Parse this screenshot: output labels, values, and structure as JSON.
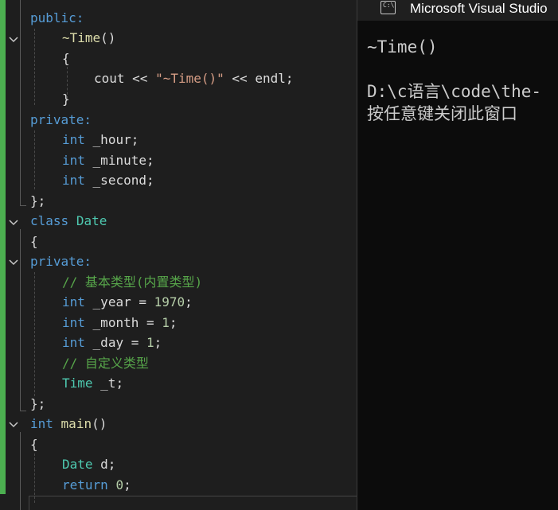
{
  "editor": {
    "line_public": "public:",
    "dtor_name": "~Time",
    "parens": "()",
    "brace_open": "{",
    "brace_close": "}",
    "cout": "cout",
    "stream_op": "<<",
    "string_literal": "\"~Time()\"",
    "endl": "endl;",
    "private_label": "private:",
    "kw_int": "int",
    "var_hour": "_hour;",
    "var_minute": "_minute;",
    "var_second": "_second;",
    "class_end": "};",
    "kw_class": "class",
    "class_name": "Date",
    "comment_builtin": "// 基本类型(内置类型)",
    "var_year": "_year",
    "var_month": "_month",
    "var_day": "_day",
    "eq": "=",
    "num_1970": "1970",
    "num_1": "1",
    "semicolon": ";",
    "comment_custom": "// 自定义类型",
    "type_time": "Time",
    "var_t": "_t;",
    "fn_main": "main",
    "type_date": "Date",
    "var_d": "d;",
    "kw_return": "return",
    "num_0": "0"
  },
  "console": {
    "window_title": "Microsoft Visual Studio",
    "icon_text": "C:\\",
    "output_line_1": "~Time()",
    "output_line_2": "D:\\c语言\\code\\the-",
    "output_line_3": "按任意键关闭此窗口"
  }
}
